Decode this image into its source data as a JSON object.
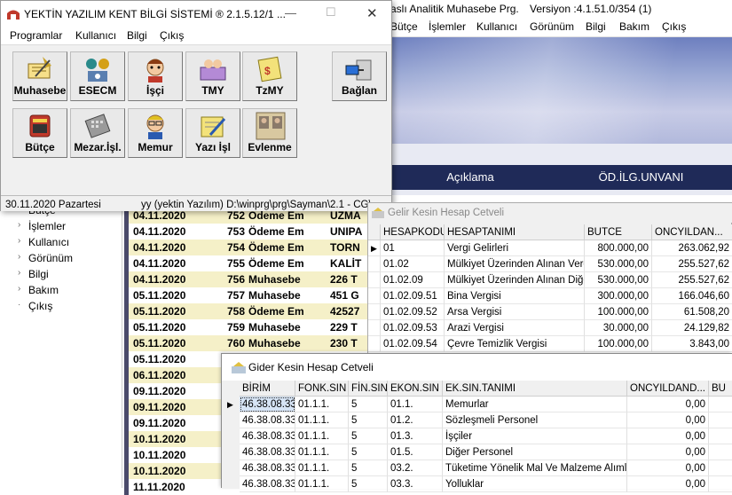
{
  "background_app": {
    "title_fragment": "aslı Analitik Muhasebe Prg.",
    "version": "Versiyon :4.1.51.0/354  (1)",
    "menu": [
      "Bütçe",
      "İşlemler",
      "Kullanıcı",
      "Görünüm",
      "Bilgi",
      "Bakım",
      "Çıkış"
    ],
    "header_cols": [
      "Açıklama",
      "ÖD.İLG.UNVANI"
    ],
    "tree_items": [
      "Bütçe",
      "İşlemler",
      "Kullanıcı",
      "Görünüm",
      "Bilgi",
      "Bakım",
      "Çıkış"
    ],
    "ledger_rows": [
      {
        "date": "04.11.2020",
        "no": "752",
        "type": "Ödeme Em",
        "extra": "UZMA"
      },
      {
        "date": "04.11.2020",
        "no": "753",
        "type": "Ödeme Em",
        "extra": "UNIPA"
      },
      {
        "date": "04.11.2020",
        "no": "754",
        "type": "Ödeme Em",
        "extra": "TORN"
      },
      {
        "date": "04.11.2020",
        "no": "755",
        "type": "Ödeme Em",
        "extra": "KALİT"
      },
      {
        "date": "04.11.2020",
        "no": "756",
        "type": "Muhasebe",
        "extra": "226 T"
      },
      {
        "date": "05.11.2020",
        "no": "757",
        "type": "Muhasebe",
        "extra": "451 G"
      },
      {
        "date": "05.11.2020",
        "no": "758",
        "type": "Ödeme Em",
        "extra": "42527"
      },
      {
        "date": "05.11.2020",
        "no": "759",
        "type": "Muhasebe",
        "extra": "229 T"
      },
      {
        "date": "05.11.2020",
        "no": "760",
        "type": "Muhasebe",
        "extra": "230 T"
      },
      {
        "date": "05.11.2020",
        "no": "",
        "type": "",
        "extra": ""
      },
      {
        "date": "06.11.2020",
        "no": "",
        "type": "",
        "extra": ""
      },
      {
        "date": "09.11.2020",
        "no": "",
        "type": "",
        "extra": ""
      },
      {
        "date": "09.11.2020",
        "no": "",
        "type": "",
        "extra": ""
      },
      {
        "date": "09.11.2020",
        "no": "",
        "type": "",
        "extra": ""
      },
      {
        "date": "10.11.2020",
        "no": "",
        "type": "",
        "extra": ""
      },
      {
        "date": "10.11.2020",
        "no": "",
        "type": "",
        "extra": ""
      },
      {
        "date": "10.11.2020",
        "no": "",
        "type": "",
        "extra": ""
      },
      {
        "date": "11.11.2020",
        "no": "",
        "type": "",
        "extra": ""
      }
    ]
  },
  "launcher": {
    "title": "YEKTİN YAZILIM KENT BİLGİ SİSTEMİ  ® 2.1.5.12/1  ...",
    "controls": {
      "minimize": "—",
      "maximize": "☐",
      "close": "✕"
    },
    "menu": [
      "Programlar",
      "Kullanıcı",
      "Bilgi",
      "Çıkış"
    ],
    "tiles_row1": [
      {
        "label": "Muhasebe",
        "icon": "muhasebe-icon"
      },
      {
        "label": "ESECM",
        "icon": "esecm-icon"
      },
      {
        "label": "İşçi",
        "icon": "isci-icon"
      },
      {
        "label": "TMY",
        "icon": "tmy-icon"
      },
      {
        "label": "TzMY",
        "icon": "tzmy-icon"
      }
    ],
    "tiles_row2": [
      {
        "label": "Bütçe",
        "icon": "butce-icon"
      },
      {
        "label": "Mezar.İşl.",
        "icon": "mezar-icon"
      },
      {
        "label": "Memur",
        "icon": "memur-icon"
      },
      {
        "label": "Yazı İşl",
        "icon": "yazi-icon"
      },
      {
        "label": "Evlenme",
        "icon": "evlenme-icon"
      }
    ],
    "connect_label": "Bağlan",
    "status_date": "30.11.2020 Pazartesi",
    "status_path": "yy (yektin  Yazılım) D:\\winprg\\prg\\Sayman\\2.1 - CG\\"
  },
  "gelir": {
    "title": "Gelir Kesin Hesap Cetveli",
    "columns": [
      "HESAPKODU",
      "HESAPTANIMI",
      "BUTCE",
      "ONCYILDAN..."
    ],
    "rows": [
      [
        "01",
        "Vergi Gelirleri",
        "800.000,00",
        "263.062,92"
      ],
      [
        "01.02",
        "Mülkiyet Üzerinden Alınan Vergile",
        "530.000,00",
        "255.527,62"
      ],
      [
        "01.02.09",
        "Mülkiyet Üzerinden Alınan Diğer V",
        "530.000,00",
        "255.527,62"
      ],
      [
        "01.02.09.51",
        "Bina Vergisi",
        "300.000,00",
        "166.046,60"
      ],
      [
        "01.02.09.52",
        "Arsa Vergisi",
        "100.000,00",
        "61.508,20"
      ],
      [
        "01.02.09.53",
        "Arazi Vergisi",
        "30.000,00",
        "24.129,82"
      ],
      [
        "01.02.09.54",
        "Çevre Temizlik Vergisi",
        "100.000,00",
        "3.843,00"
      ]
    ]
  },
  "gider": {
    "title": "Gider Kesin Hesap Cetveli",
    "columns": [
      "BİRİM",
      "FONK.SIN",
      "FİN.SIN",
      "EKON.SIN",
      "EK.SIN.TANIMI",
      "ONCYILDAND...",
      "BU"
    ],
    "rows": [
      [
        "46.38.08.33",
        "01.1.1.",
        "5",
        "01.1.",
        "Memurlar",
        "0,00"
      ],
      [
        "46.38.08.33",
        "01.1.1.",
        "5",
        "01.2.",
        "Sözleşmeli  Personel",
        "0,00"
      ],
      [
        "46.38.08.33",
        "01.1.1.",
        "5",
        "01.3.",
        "İşçiler",
        "0,00"
      ],
      [
        "46.38.08.33",
        "01.1.1.",
        "5",
        "01.5.",
        "Diğer Personel",
        "0,00"
      ],
      [
        "46.38.08.33",
        "01.1.1.",
        "5",
        "03.2.",
        "Tüketime Yönelik Mal Ve Malzeme Alımları",
        "0,00"
      ],
      [
        "46.38.08.33",
        "01.1.1.",
        "5",
        "03.3.",
        "Yolluklar",
        "0,00"
      ]
    ]
  },
  "colors": {
    "ledger_row": "#f5f0c8",
    "nav_header": "#1f2a58",
    "selected_cell": "#d6e4f5"
  }
}
